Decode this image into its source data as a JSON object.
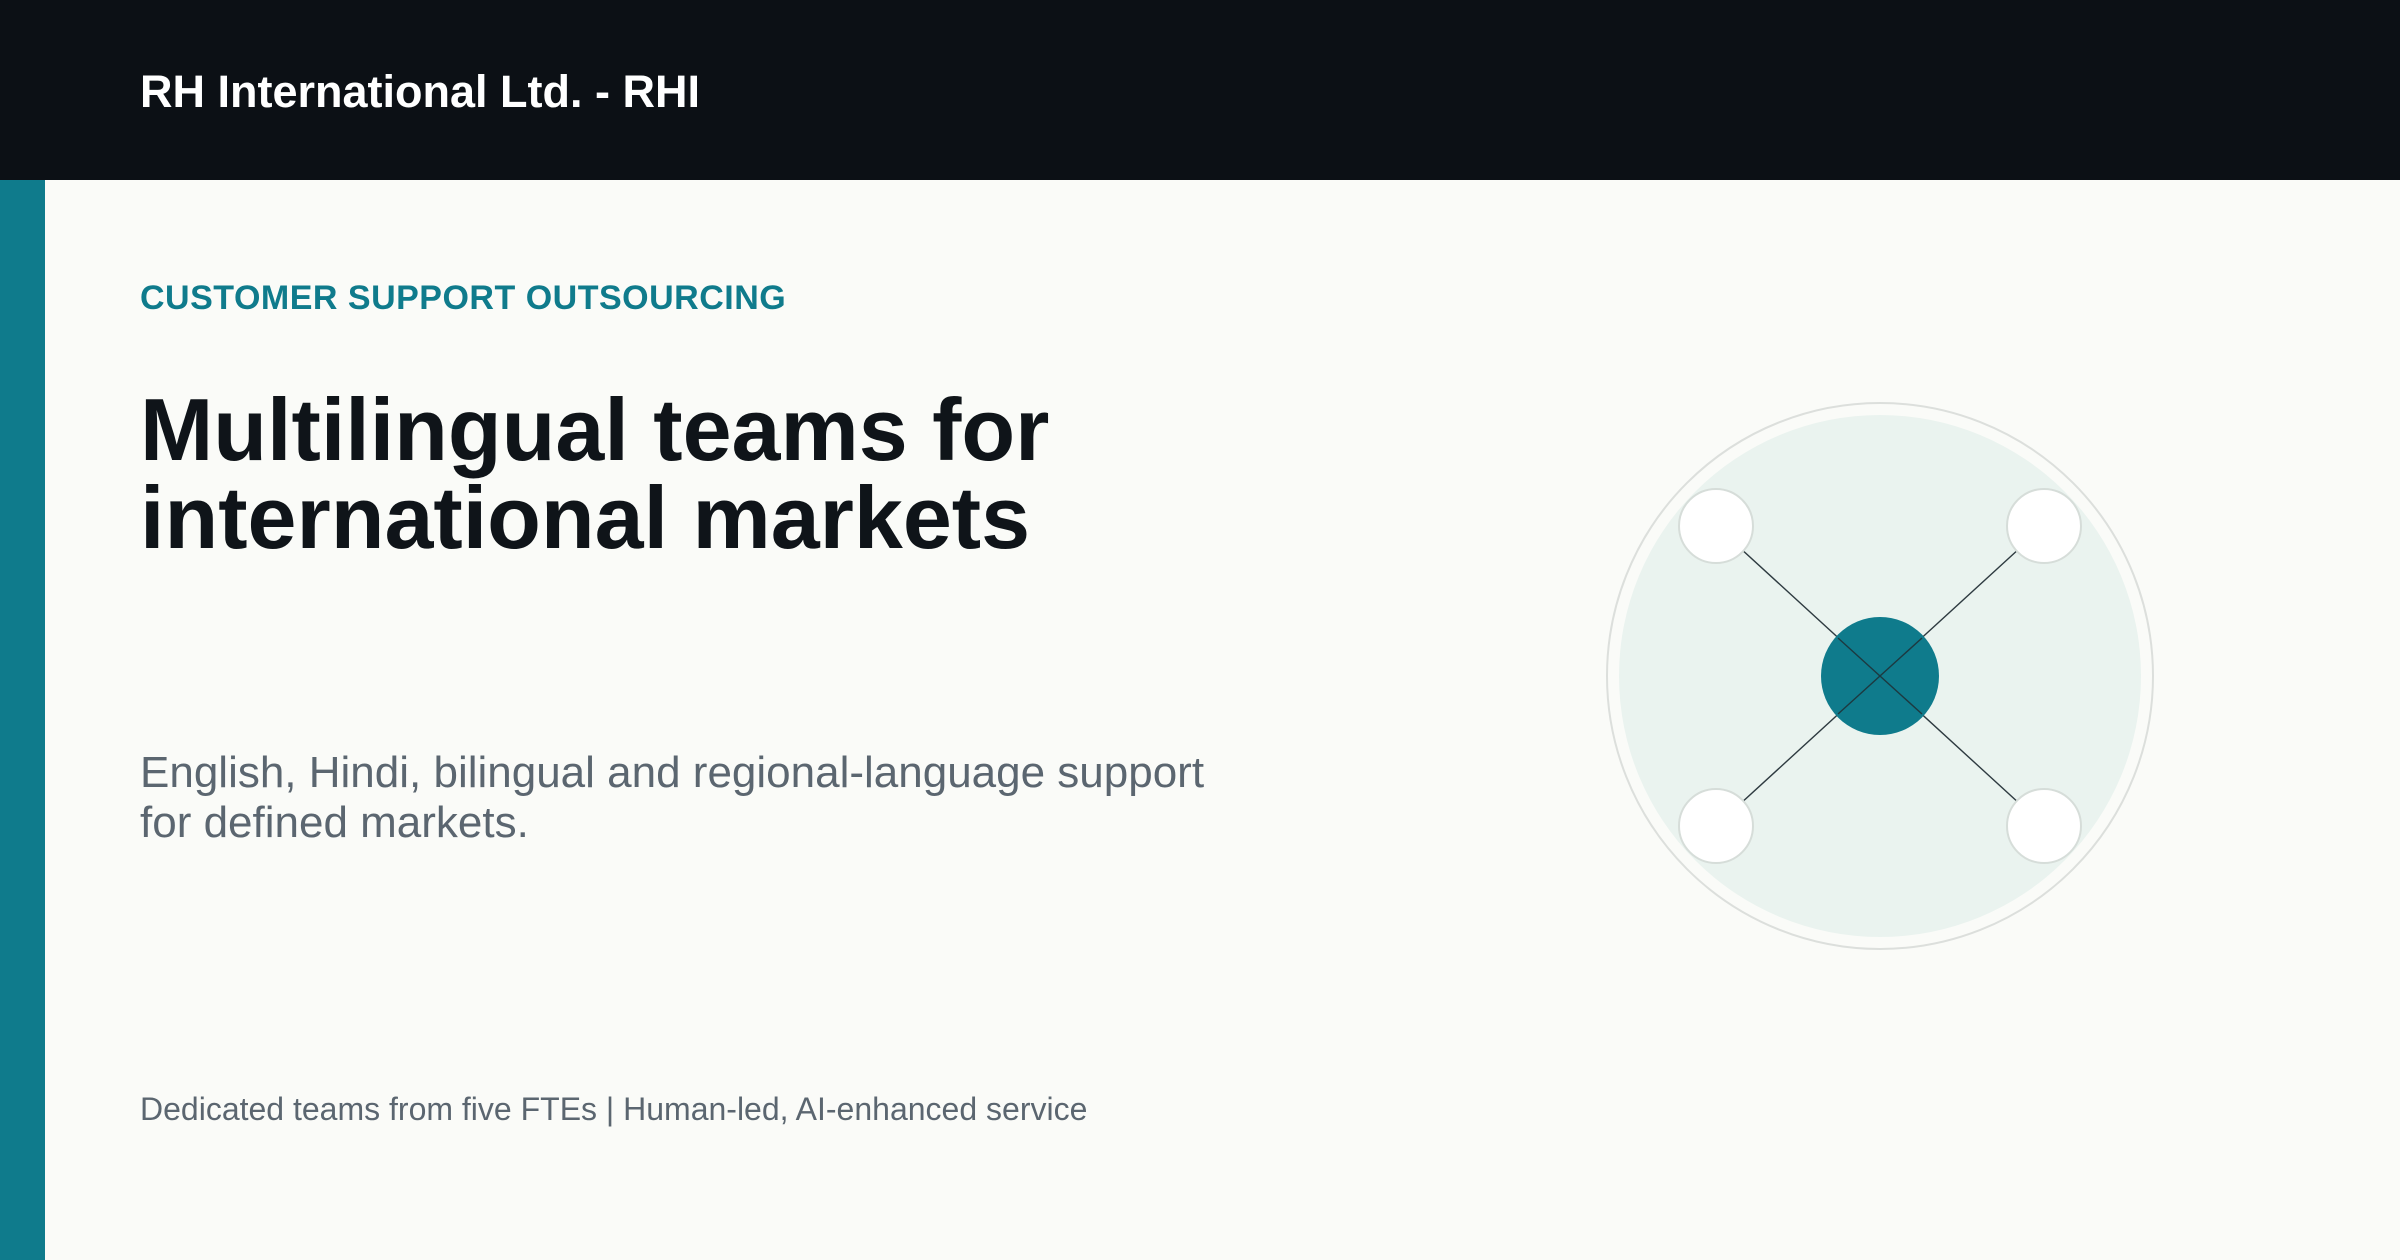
{
  "header": {
    "brand": "RH International Ltd. - RHI"
  },
  "hero": {
    "eyebrow": "CUSTOMER SUPPORT OUTSOURCING",
    "headline_lines": [
      "Multilingual teams for",
      "international markets"
    ],
    "subtext_lines": [
      "English, Hindi, bilingual and regional-language support",
      "for defined markets."
    ],
    "footnote": "Dedicated teams from five FTEs | Human-led, AI-enhanced service"
  },
  "illustration": {
    "icon": "hub-network-icon",
    "satellite_count": 4
  },
  "colors": {
    "accent": "#0f7b8c",
    "header_bg": "#0c1015",
    "page_bg": "#fafbf8",
    "headline": "#0f1419",
    "muted_text": "#5b6670",
    "disc_fill": "#eaf3ef",
    "node_fill": "#ffffff"
  }
}
